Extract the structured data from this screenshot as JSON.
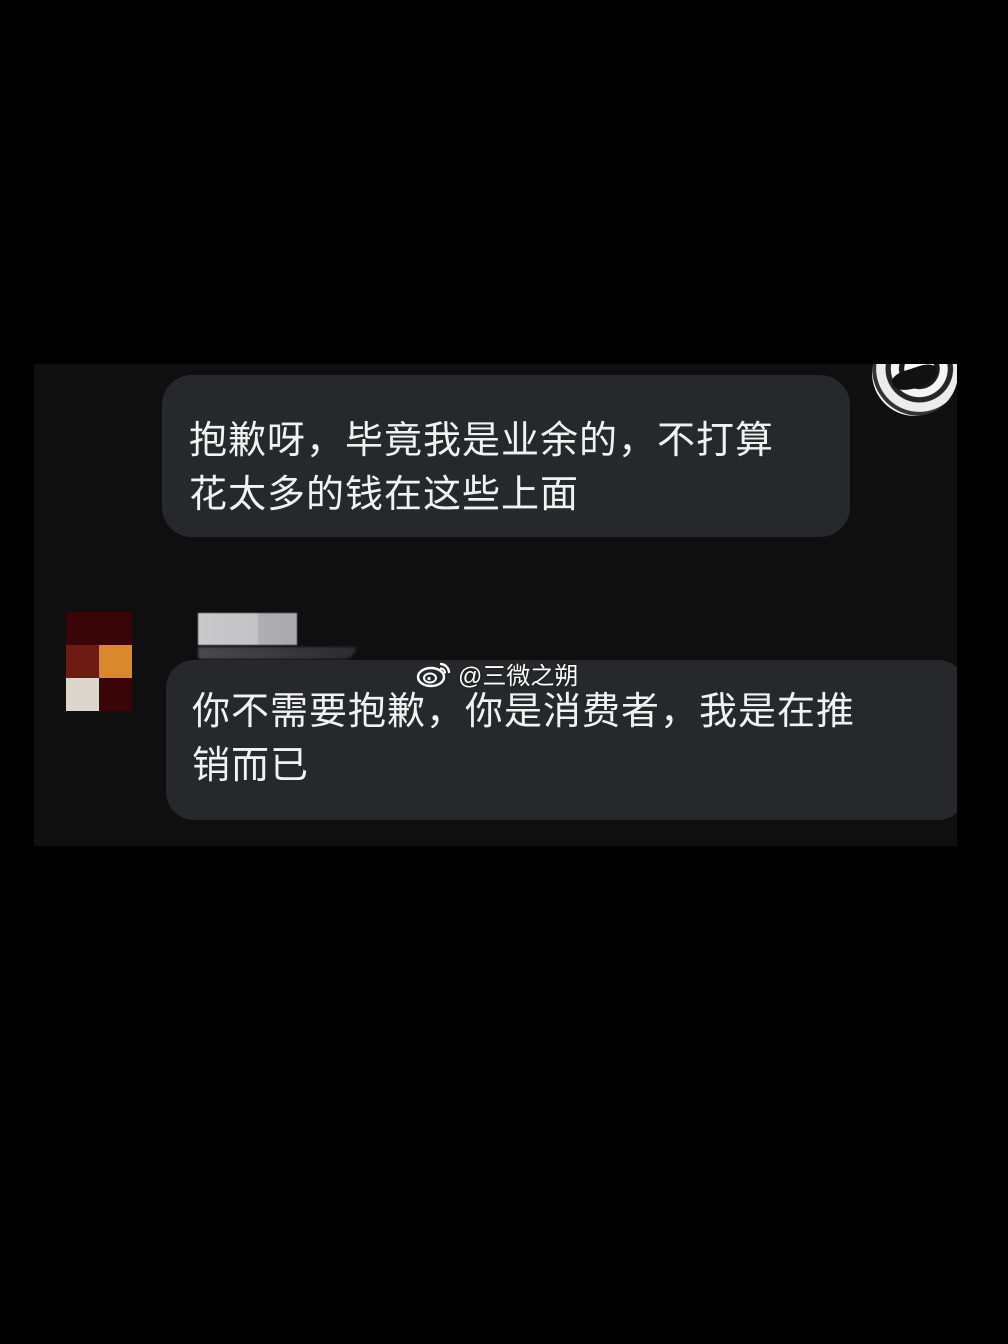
{
  "conversation": {
    "messages": [
      {
        "sender": "self",
        "text": "抱歉呀，毕竟我是业余的，不打算\n花太多的钱在这些上面"
      },
      {
        "sender": "contact",
        "text": "你不需要抱歉，你是消费者，我是在推\n销而已"
      }
    ]
  },
  "contact": {
    "avatar_colors": [
      "#3a0508",
      "#3a0508",
      "#6e1b12",
      "#d9882a",
      "#dcd6cc",
      "#3a0508"
    ]
  },
  "watermark": {
    "icon": "weibo-icon",
    "text": "@三微之朔"
  },
  "colors": {
    "background": "#000000",
    "panel": "#0f0f10",
    "bubble": "#27282b",
    "text": "#f2f2f2"
  }
}
